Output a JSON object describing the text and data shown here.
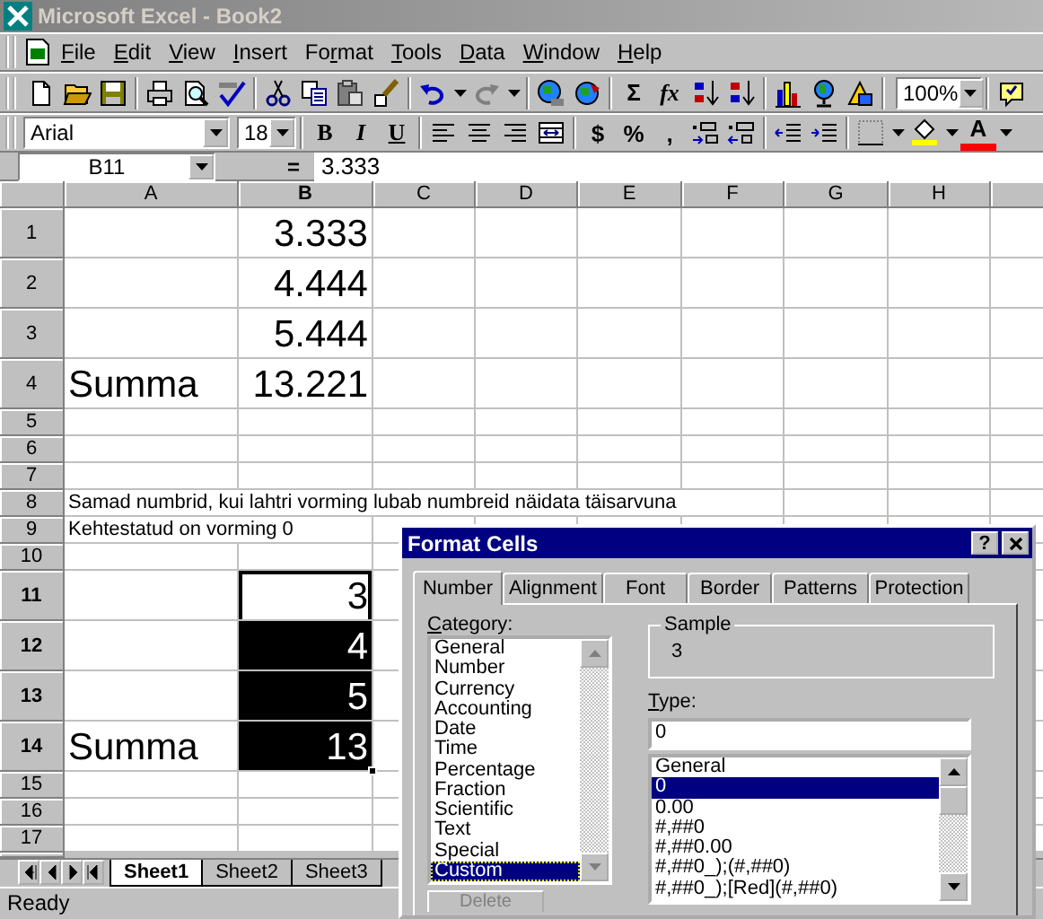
{
  "window": {
    "title": "Microsoft Excel - Book2"
  },
  "menu": [
    {
      "key": "F",
      "post": "ile"
    },
    {
      "key": "E",
      "post": "dit"
    },
    {
      "key": "V",
      "post": "iew"
    },
    {
      "key": "I",
      "post": "nsert"
    },
    {
      "pre": "Fo",
      "key": "r",
      "post": "mat"
    },
    {
      "key": "T",
      "post": "ools"
    },
    {
      "key": "D",
      "post": "ata"
    },
    {
      "key": "W",
      "post": "indow"
    },
    {
      "key": "H",
      "post": "elp"
    }
  ],
  "standard_toolbar": {
    "sum_label": "Σ",
    "function_label": "fx",
    "zoom": "100%"
  },
  "formatting_toolbar": {
    "font": "Arial",
    "size": "18",
    "bold_label": "B",
    "italic_label": "I",
    "underline_label": "U",
    "currency_label": "$",
    "percent_label": "%",
    "comma_label": ",",
    "font_color_label": "A"
  },
  "formula_bar": {
    "name_box": "B11",
    "equals": "=",
    "value": "3.333"
  },
  "columns": [
    {
      "label": "A",
      "selected": false
    },
    {
      "label": "B",
      "selected": true
    },
    {
      "label": "C",
      "selected": false
    },
    {
      "label": "D",
      "selected": false
    },
    {
      "label": "E",
      "selected": false
    },
    {
      "label": "F",
      "selected": false
    },
    {
      "label": "G",
      "selected": false
    },
    {
      "label": "H",
      "selected": false
    }
  ],
  "rows": [
    {
      "header": "1",
      "kind": "tall",
      "selected": false,
      "b": {
        "text": "3.333",
        "selected": false
      }
    },
    {
      "header": "2",
      "kind": "tall",
      "selected": false,
      "b": {
        "text": "4.444",
        "selected": false
      }
    },
    {
      "header": "3",
      "kind": "tall",
      "selected": false,
      "b": {
        "text": "5.444",
        "selected": false
      }
    },
    {
      "header": "4",
      "kind": "tall",
      "selected": false,
      "a": {
        "text": "Summa",
        "selected": false
      },
      "b": {
        "text": "13.221",
        "selected": false
      }
    },
    {
      "header": "5",
      "kind": "normal",
      "selected": false
    },
    {
      "header": "6",
      "kind": "normal",
      "selected": false
    },
    {
      "header": "7",
      "kind": "normal",
      "selected": false
    },
    {
      "header": "8",
      "kind": "normal",
      "selected": false,
      "a": {
        "text": "Samad numbrid, kui lahtri vorming lubab numbreid näidata täisarvuna",
        "selected": false
      }
    },
    {
      "header": "9",
      "kind": "normal",
      "selected": false,
      "a": {
        "text": "Kehtestatud on vorming 0",
        "selected": false
      }
    },
    {
      "header": "10",
      "kind": "normal",
      "selected": false
    },
    {
      "header": "11",
      "kind": "tall",
      "selected": true,
      "b": {
        "text": "3",
        "selected": true
      }
    },
    {
      "header": "12",
      "kind": "tall",
      "selected": true,
      "b": {
        "text": "4",
        "selected": true
      }
    },
    {
      "header": "13",
      "kind": "tall",
      "selected": true,
      "b": {
        "text": "5",
        "selected": true
      }
    },
    {
      "header": "14",
      "kind": "tall",
      "selected": true,
      "a": {
        "text": "Summa",
        "selected": false
      },
      "b": {
        "text": "13",
        "selected": true
      }
    },
    {
      "header": "15",
      "kind": "normal",
      "selected": false
    },
    {
      "header": "16",
      "kind": "normal",
      "selected": false
    },
    {
      "header": "17",
      "kind": "normal",
      "selected": false
    }
  ],
  "sheet_tabs": [
    {
      "label": "Sheet1",
      "selected": true
    },
    {
      "label": "Sheet2",
      "selected": false
    },
    {
      "label": "Sheet3",
      "selected": false
    }
  ],
  "status_bar": "Ready",
  "dialog": {
    "title": "Format Cells",
    "help_label": "?",
    "tabs": [
      {
        "label": "Number",
        "selected": true
      },
      {
        "label": "Alignment",
        "selected": false
      },
      {
        "label": "Font",
        "selected": false
      },
      {
        "label": "Border",
        "selected": false
      },
      {
        "label": "Patterns",
        "selected": false
      },
      {
        "label": "Protection",
        "selected": false
      }
    ],
    "category_label": {
      "key": "C",
      "post": "ategory:"
    },
    "categories": [
      {
        "label": "General",
        "selected": false
      },
      {
        "label": "Number",
        "selected": false
      },
      {
        "label": "Currency",
        "selected": false
      },
      {
        "label": "Accounting",
        "selected": false
      },
      {
        "label": "Date",
        "selected": false
      },
      {
        "label": "Time",
        "selected": false
      },
      {
        "label": "Percentage",
        "selected": false
      },
      {
        "label": "Fraction",
        "selected": false
      },
      {
        "label": "Scientific",
        "selected": false
      },
      {
        "label": "Text",
        "selected": false
      },
      {
        "label": "Special",
        "selected": false
      },
      {
        "label": "Custom",
        "selected": true
      }
    ],
    "sample": {
      "label": "Sample",
      "value": "3"
    },
    "type_label": {
      "key": "T",
      "post": "ype:"
    },
    "type_value": "0",
    "types": [
      {
        "label": "General",
        "selected": false
      },
      {
        "label": "0",
        "selected": true
      },
      {
        "label": "0.00",
        "selected": false
      },
      {
        "label": "#,##0",
        "selected": false
      },
      {
        "label": "#,##0.00",
        "selected": false
      },
      {
        "label": "#,##0_);(#,##0)",
        "selected": false
      },
      {
        "label": "#,##0_);[Red](#,##0)",
        "selected": false
      }
    ],
    "delete_button": {
      "label": "Delete",
      "disabled": true
    }
  }
}
